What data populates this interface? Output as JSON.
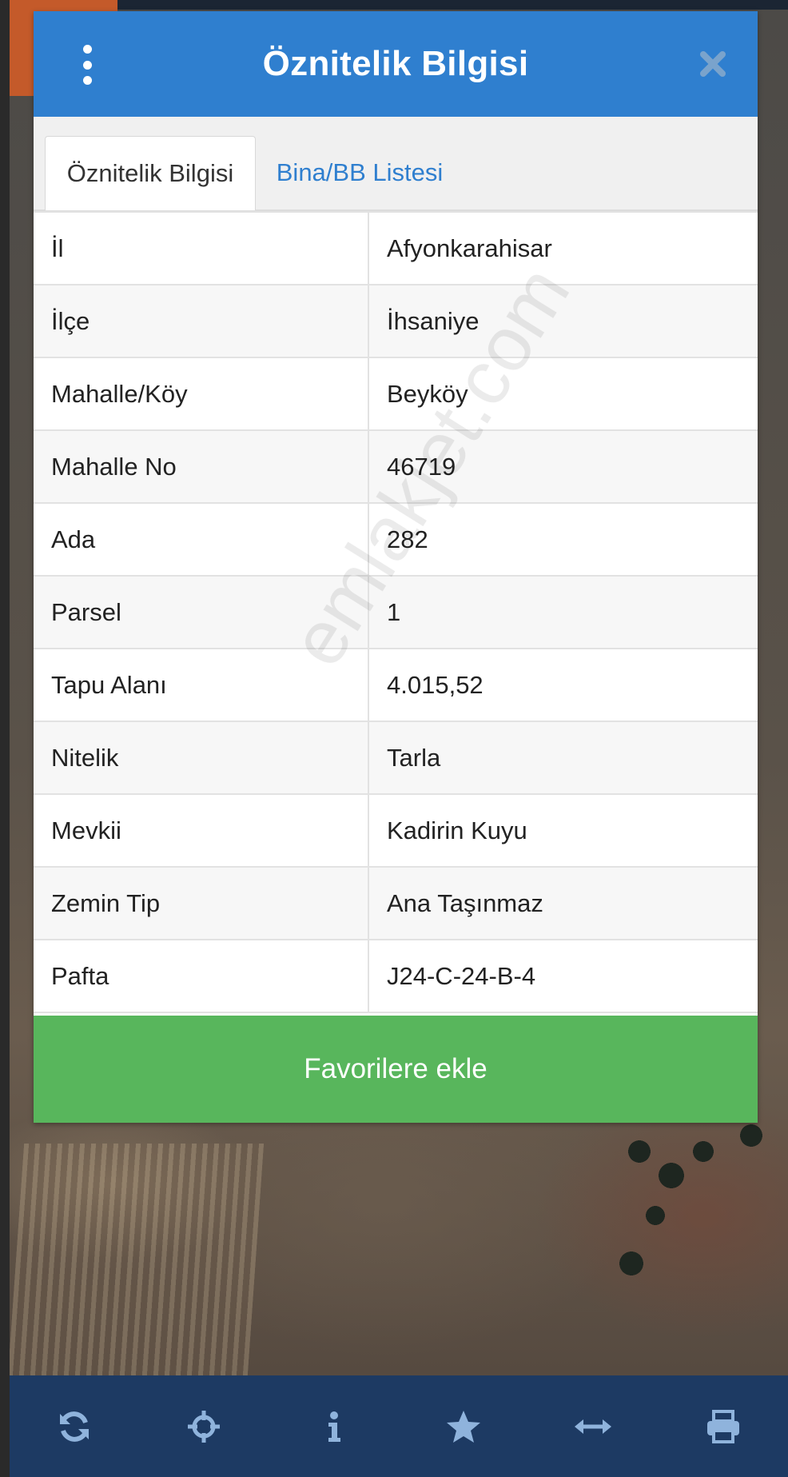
{
  "dialog": {
    "title": "Öznitelik Bilgisi",
    "tabs": [
      {
        "label": "Öznitelik Bilgisi",
        "active": true
      },
      {
        "label": "Bina/BB Listesi",
        "active": false
      }
    ],
    "rows": [
      {
        "key": "İl",
        "value": "Afyonkarahisar"
      },
      {
        "key": "İlçe",
        "value": "İhsaniye"
      },
      {
        "key": "Mahalle/Köy",
        "value": "Beyköy"
      },
      {
        "key": "Mahalle No",
        "value": "46719"
      },
      {
        "key": "Ada",
        "value": "282"
      },
      {
        "key": "Parsel",
        "value": "1"
      },
      {
        "key": "Tapu Alanı",
        "value": "4.015,52"
      },
      {
        "key": "Nitelik",
        "value": "Tarla"
      },
      {
        "key": "Mevkii",
        "value": "Kadirin Kuyu"
      },
      {
        "key": "Zemin Tip",
        "value": "Ana Taşınmaz"
      },
      {
        "key": "Pafta",
        "value": "J24-C-24-B-4"
      }
    ],
    "favorite_button": "Favorilere ekle",
    "watermark": "emlakjet.com"
  },
  "toolbar": {
    "icons": [
      "refresh-icon",
      "crosshair-icon",
      "info-icon",
      "star-icon",
      "measure-arrows-icon",
      "print-icon"
    ]
  },
  "colors": {
    "header": "#2f7fcf",
    "favorite": "#58b65c",
    "toolbar": "#1d3a63"
  }
}
